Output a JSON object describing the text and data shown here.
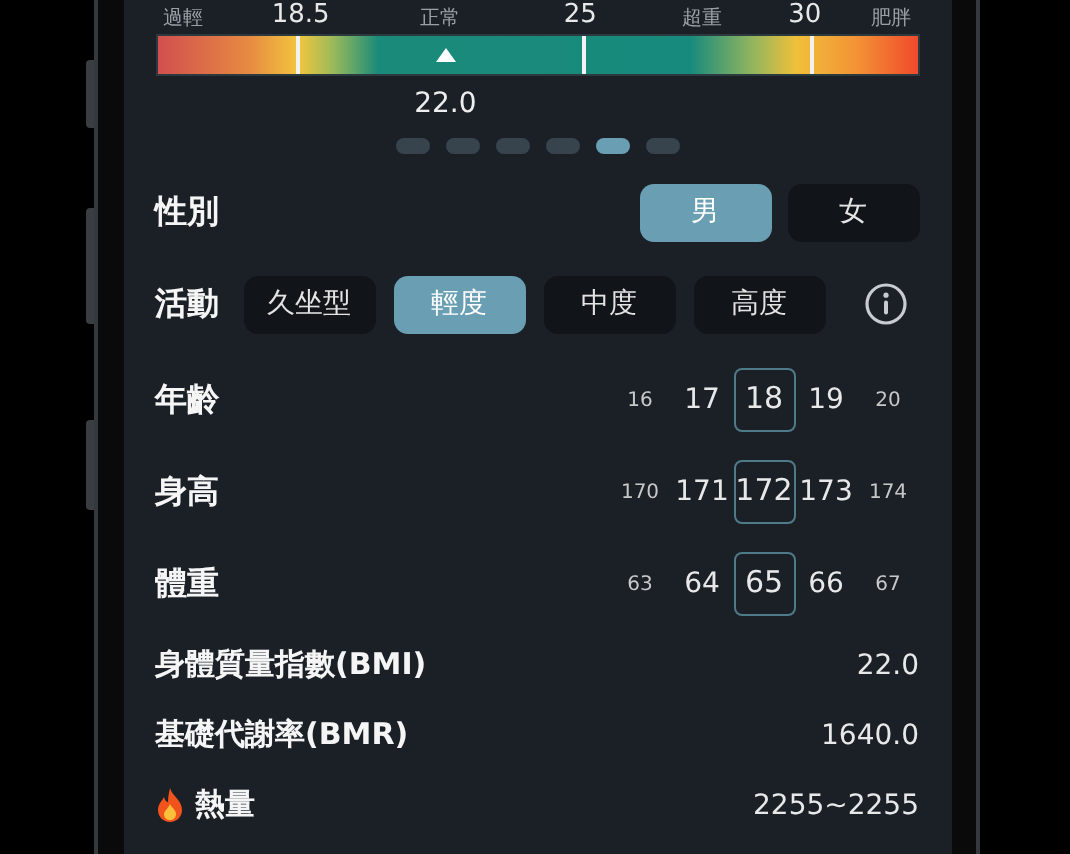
{
  "scale": {
    "labels": [
      {
        "kind": "zone",
        "text": "過輕"
      },
      {
        "kind": "value",
        "text": "18.5"
      },
      {
        "kind": "zone",
        "text": "正常"
      },
      {
        "kind": "value",
        "text": "25"
      },
      {
        "kind": "zone",
        "text": "超重"
      },
      {
        "kind": "value",
        "text": "30"
      },
      {
        "kind": "zone",
        "text": "肥胖"
      }
    ],
    "level": 0.38,
    "value": "22.0"
  },
  "pages": [
    {
      "selected": false
    },
    {
      "selected": false
    },
    {
      "selected": false
    },
    {
      "selected": false
    },
    {
      "selected": true
    },
    {
      "selected": false
    }
  ],
  "gender": {
    "label": "性別",
    "options": [
      {
        "label": "男",
        "selected": true
      },
      {
        "label": "女",
        "selected": false
      }
    ]
  },
  "activity": {
    "label": "活動",
    "options": [
      {
        "label": "久坐型",
        "selected": false
      },
      {
        "label": "輕度",
        "selected": true
      },
      {
        "label": "中度",
        "selected": false
      },
      {
        "label": "高度",
        "selected": false
      }
    ]
  },
  "pickers": [
    {
      "label": "年齡",
      "values": [
        {
          "text": "16",
          "selected": false
        },
        {
          "text": "17",
          "selected": false
        },
        {
          "text": "18",
          "selected": true
        },
        {
          "text": "19",
          "selected": false
        },
        {
          "text": "20",
          "selected": false
        }
      ]
    },
    {
      "label": "身高",
      "values": [
        {
          "text": "170",
          "selected": false
        },
        {
          "text": "171",
          "selected": false
        },
        {
          "text": "172",
          "selected": true
        },
        {
          "text": "173",
          "selected": false
        },
        {
          "text": "174",
          "selected": false
        }
      ]
    },
    {
      "label": "體重",
      "values": [
        {
          "text": "63",
          "selected": false
        },
        {
          "text": "64",
          "selected": false
        },
        {
          "text": "65",
          "selected": true
        },
        {
          "text": "66",
          "selected": false
        },
        {
          "text": "67",
          "selected": false
        }
      ]
    }
  ],
  "results": [
    {
      "label": "身體質量指數(BMI)",
      "value": "22.0",
      "icon": false
    },
    {
      "label": "基礎代謝率(BMR)",
      "value": "1640.0",
      "icon": false
    },
    {
      "label": "熱量",
      "value": "2255~2255",
      "icon": true
    }
  ]
}
